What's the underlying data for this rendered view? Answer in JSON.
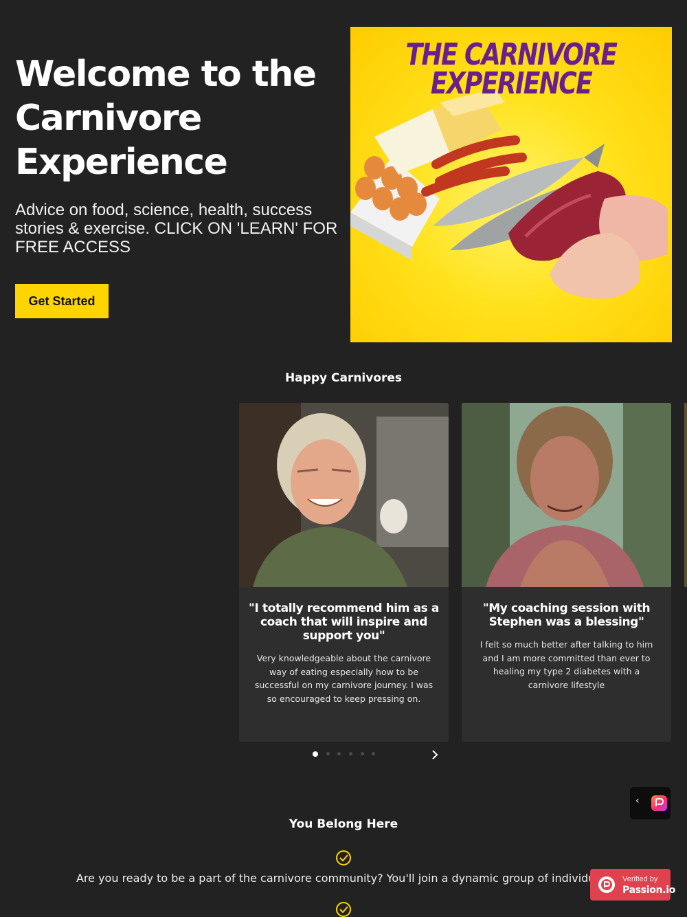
{
  "hero": {
    "title": "Welcome to the Carnivore Experience",
    "subtitle": "Advice on food, science, health, success stories & exercise. CLICK ON 'LEARN' FOR FREE ACCESS",
    "cta_label": "Get Started",
    "image": {
      "title_line1": "THE CARNIVORE",
      "title_line2": "EXPERIENCE"
    }
  },
  "testimonials": {
    "heading": "Happy Carnivores",
    "cards": [
      {
        "quote": "\"I totally recommend him as a coach that will inspire and support you\"",
        "body": "Very knowledgeable about the carnivore way of eating especially how to be successful on my carnivore journey. I was so encouraged to keep pressing on."
      },
      {
        "quote": "\"My coaching session with Stephen was a blessing\"",
        "body": "I felt so much better after talking to him and I am more committed than ever to healing my type 2 diabetes with a carnivore lifestyle"
      }
    ],
    "carousel": {
      "page_count": 6,
      "active_page": 1,
      "next_icon": "chevron-right-icon"
    }
  },
  "belong": {
    "heading": "You Belong Here",
    "items": [
      "Are you ready to be a part of the carnivore community? You'll join a dynamic group of individuals"
    ]
  },
  "widget": {
    "back_icon": "chevron-left-icon",
    "logo_icon": "passion-logo-icon"
  },
  "verified": {
    "small": "Verified by",
    "big": "Passion.io"
  },
  "colors": {
    "background": "#222222",
    "accent": "#ffd500",
    "card": "#2e2e2e",
    "verified": "#e0414f",
    "image_title": "#6a1f8f"
  }
}
